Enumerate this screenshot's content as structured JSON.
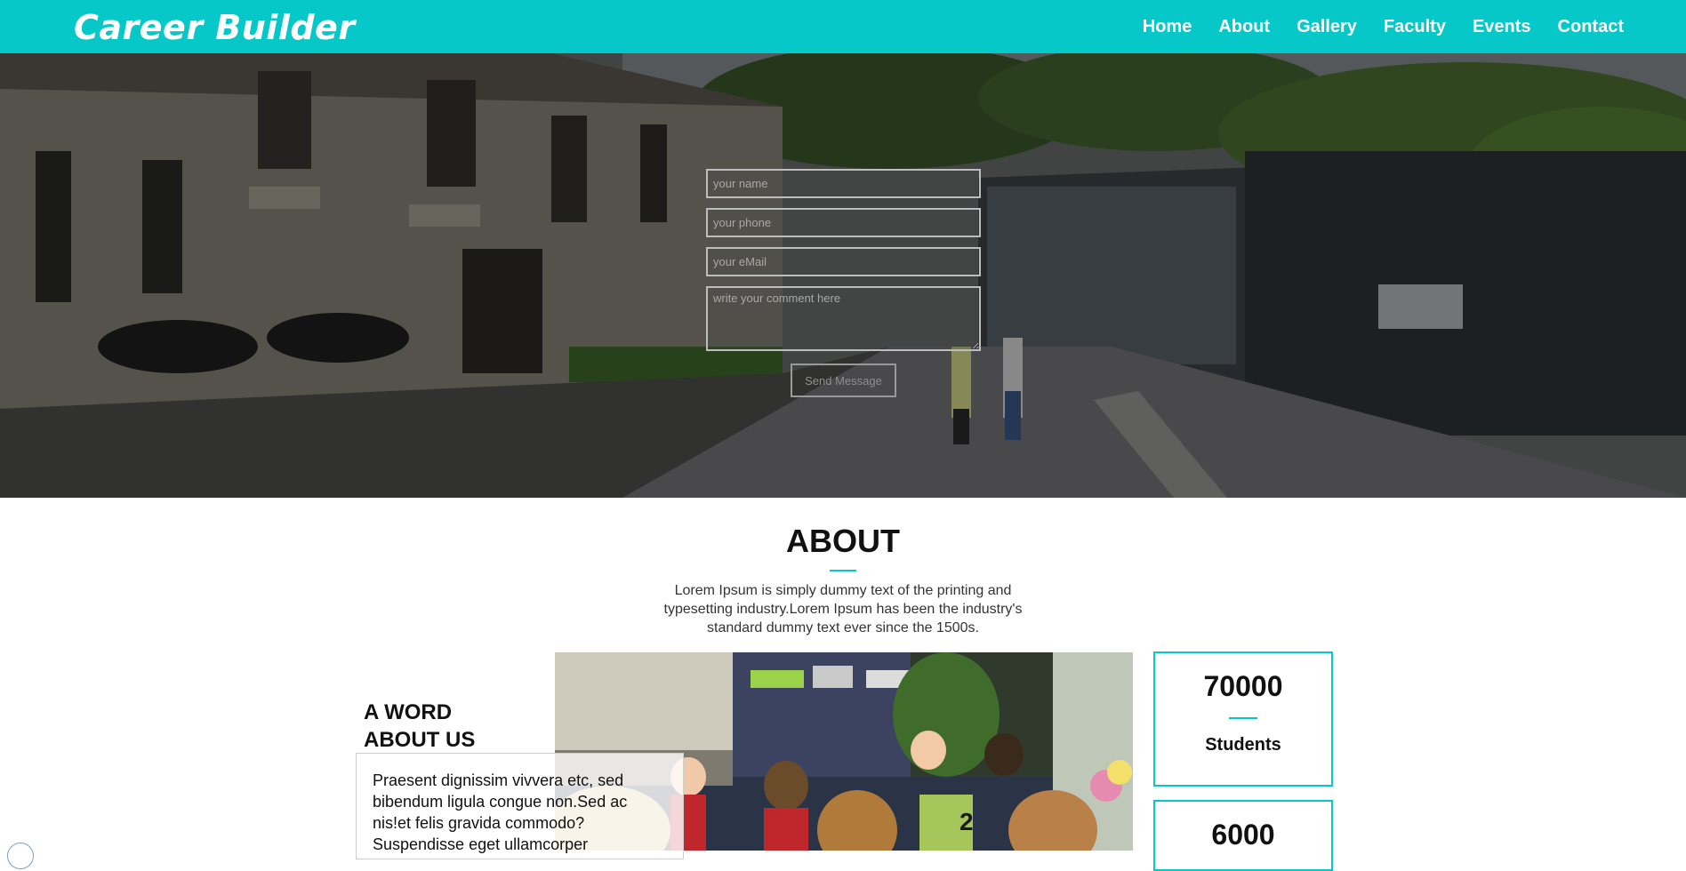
{
  "brand": {
    "name": "Career Builder"
  },
  "nav": {
    "items": [
      {
        "label": "Home"
      },
      {
        "label": "About"
      },
      {
        "label": "Gallery"
      },
      {
        "label": "Faculty"
      },
      {
        "label": "Events"
      },
      {
        "label": "Contact"
      }
    ]
  },
  "contact_form": {
    "name_placeholder": "your name",
    "phone_placeholder": "your phone",
    "email_placeholder": "your eMail",
    "comment_placeholder": "write your comment here",
    "submit_label": "Send Message"
  },
  "about": {
    "title": "ABOUT",
    "description": "Lorem Ipsum is simply dummy text of the printing and typesetting industry.Lorem Ipsum has been the industry's standard dummy text ever since the 1500s."
  },
  "word_about": {
    "title_line1": "A WORD",
    "title_line2": "ABOUT US",
    "text": "Praesent dignissim vivvera etc, sed bibendum ligula congue non.Sed ac nis!et felis gravida commodo? Suspendisse eget ullamcorper"
  },
  "stats": [
    {
      "number": "70000",
      "label": "Students"
    },
    {
      "number": "6000",
      "label": ""
    }
  ],
  "colors": {
    "accent": "#07c8c8",
    "nav_text": "#ffffff"
  }
}
